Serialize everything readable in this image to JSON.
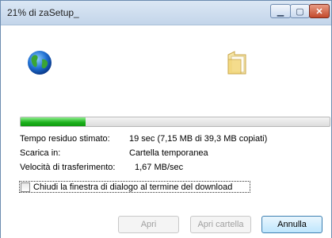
{
  "window": {
    "title": "21% di zaSetup_",
    "controls": {
      "minimize_icon": "minimize-icon",
      "maximize_icon": "maximize-icon",
      "close_icon": "close-icon"
    }
  },
  "progress": {
    "percent": 21,
    "color": "#1eb21e"
  },
  "details": {
    "time_label": "Tempo residuo stimato:",
    "time_value": "19 sec (7,15 MB di 39,3 MB copiati)",
    "download_label": "Scarica in:",
    "download_value": "Cartella temporanea",
    "speed_label": "Velocità di trasferimento:",
    "speed_value": "1,67 MB/sec"
  },
  "checkbox": {
    "label": "Chiudi la finestra di dialogo al termine del download",
    "checked": false
  },
  "buttons": {
    "open": "Apri",
    "open_folder": "Apri cartella",
    "cancel": "Annulla"
  },
  "icons": {
    "source": "globe-icon",
    "destination": "folder-icon"
  }
}
